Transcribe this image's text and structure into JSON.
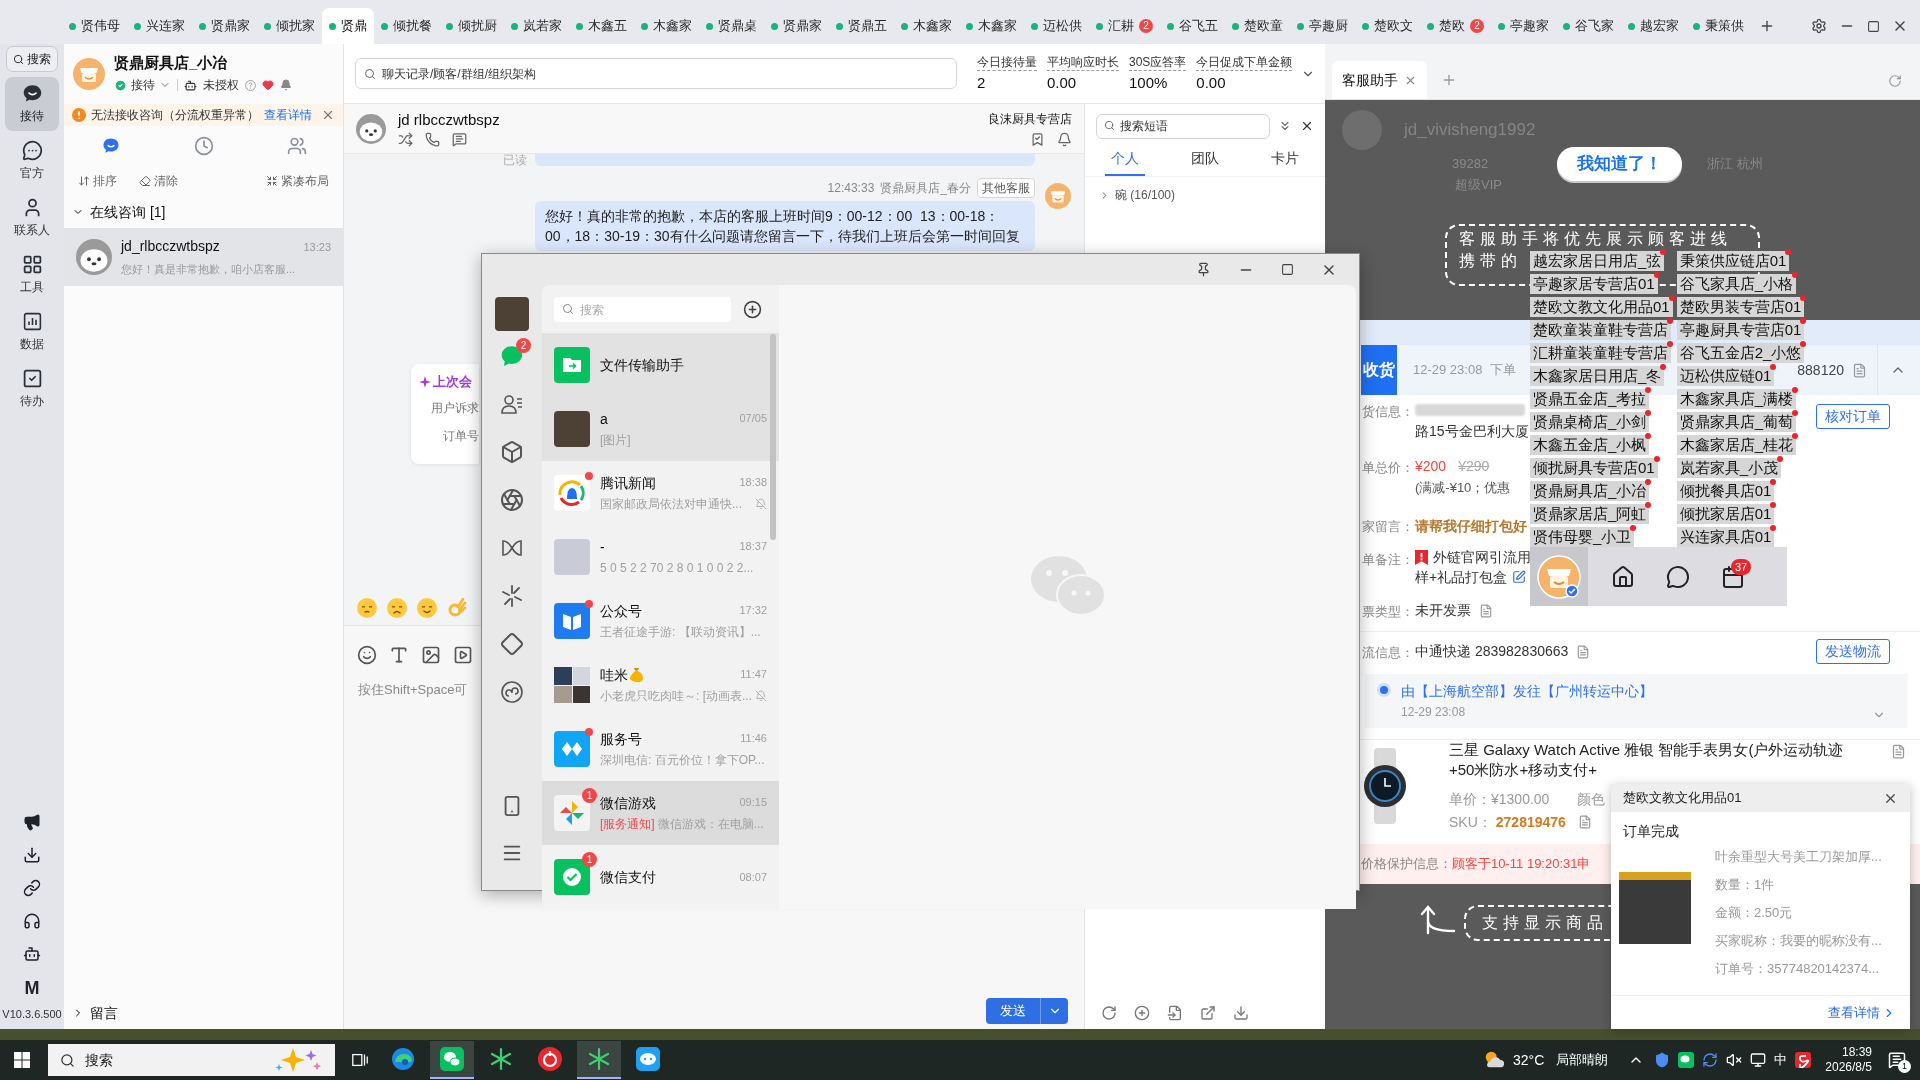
{
  "top_tabs": [
    {
      "label": "贤伟母",
      "selected": false
    },
    {
      "label": "兴连家",
      "selected": false
    },
    {
      "label": "贤鼎家",
      "selected": false
    },
    {
      "label": "倾扰家",
      "selected": false
    },
    {
      "label": "贤鼎",
      "selected": true
    },
    {
      "label": "倾扰餐",
      "selected": false
    },
    {
      "label": "倾扰厨",
      "selected": false
    },
    {
      "label": "岚若家",
      "selected": false
    },
    {
      "label": "木鑫五",
      "selected": false
    },
    {
      "label": "木鑫家",
      "selected": false
    },
    {
      "label": "贤鼎桌",
      "selected": false
    },
    {
      "label": "贤鼎家",
      "selected": false
    },
    {
      "label": "贤鼎五",
      "selected": false
    },
    {
      "label": "木鑫家",
      "selected": false
    },
    {
      "label": "木鑫家",
      "selected": false
    },
    {
      "label": "迈松供",
      "selected": false
    },
    {
      "label": "汇耕",
      "selected": false,
      "badge": "2"
    },
    {
      "label": "谷飞五",
      "selected": false
    },
    {
      "label": "楚欧童",
      "selected": false
    },
    {
      "label": "亭趣厨",
      "selected": false
    },
    {
      "label": "楚欧文",
      "selected": false
    },
    {
      "label": "楚欧",
      "selected": false,
      "badge": "2"
    },
    {
      "label": "亭趣家",
      "selected": false
    },
    {
      "label": "谷飞家",
      "selected": false
    },
    {
      "label": "越宏家",
      "selected": false
    },
    {
      "label": "秉策供",
      "selected": false
    }
  ],
  "rail": {
    "search": "搜索",
    "items": [
      {
        "label": "接待",
        "selected": true
      },
      {
        "label": "官方",
        "selected": false
      },
      {
        "label": "联系人",
        "selected": false
      },
      {
        "label": "工具",
        "selected": false
      },
      {
        "label": "数据",
        "selected": false
      },
      {
        "label": "待办",
        "selected": false
      }
    ],
    "logo": "M",
    "version": "V10.3.6.500"
  },
  "shop": {
    "name": "贤鼎厨具店_小冶",
    "status": "接待",
    "auth": "未授权",
    "alert": {
      "text": "无法接收咨询（分流权重异常）",
      "link": "查看详情"
    },
    "views": [
      {
        "selected": true
      },
      {
        "selected": false
      },
      {
        "selected": false
      }
    ],
    "actions": [
      "排序",
      "清除",
      "紧凑布局"
    ]
  },
  "groups": [
    {
      "title": "在线咨询 [1]",
      "expanded": true,
      "conversations": [
        {
          "name": "jd_rlbcczwtbspz",
          "time": "13:23",
          "preview": "您好！真是非常抱歉，咱小店客服...",
          "selected": true
        }
      ]
    }
  ],
  "footer_group": {
    "title": "留言",
    "expanded": false
  },
  "global_search": {
    "placeholder": "聊天记录/顾客/群组/组织架构"
  },
  "stats": [
    {
      "label": "今日接待量",
      "value": "2"
    },
    {
      "label": "平均响应时长",
      "value": "0.00"
    },
    {
      "label": "30S应答率",
      "value": "100%"
    },
    {
      "label": "今日促成下单金额",
      "value": "0.00"
    }
  ],
  "chat": {
    "customer": "jd rlbcczwtbspz",
    "store": "良沫厨具专营店",
    "messages": [
      {
        "kind": "cut",
        "status": "已读"
      },
      {
        "kind": "agent",
        "time": "12:43:33",
        "sender": "贤鼎厨具店_春分",
        "tag": "其他客服",
        "text": "您好！真的非常的抱歉，本店的客服上班时间9：00-12：00  13：00-18：00，18：30-19：30有什么问题请您留言一下，待我们上班后会第一时间回复"
      }
    ],
    "summary": {
      "title": "上次会",
      "lines": [
        "用户诉求",
        "订单号"
      ]
    },
    "input": {
      "placeholder": "按住Shift+Space可"
    },
    "send": "发送"
  },
  "phrases": {
    "search": {
      "placeholder": "搜索短语"
    },
    "tabs": [
      {
        "label": "个人",
        "selected": true
      },
      {
        "label": "团队",
        "selected": false
      },
      {
        "label": "卡片",
        "selected": false
      }
    ],
    "folders": [
      {
        "label": "碗 (16/100)",
        "expanded": false
      }
    ]
  },
  "assistant": {
    "tabs": [
      {
        "label": "客服助手",
        "selected": true
      }
    ],
    "profile_name": "jd_vivisheng1992",
    "profile_fields": [
      "39282",
      "浙江 杭州",
      "超级VIP"
    ],
    "guide": {
      "button": "我知道了！",
      "top_lines": [
        "客服助手将优先展示顾客进线",
        "携带的"
      ],
      "bottom_text": "支持显示商品"
    },
    "order": {
      "status": "收货",
      "time": "12-29 23:08",
      "type": "下单",
      "number": "888120",
      "address_label": "货信息：",
      "address": "路15号金巴利大厦",
      "check_button": "核对订单",
      "price_label": "单总价：",
      "price": "¥200",
      "original_price": "¥290",
      "discount": "(满减-¥10；优惠",
      "message_label": "家留言：",
      "message": "请帮我仔细打包好",
      "remark_label": "单备注：",
      "remark": "外链官网引流用",
      "remark_2": "样+礼品打包盒",
      "invoice_label": "票类型：",
      "invoice": "未开发票",
      "logistics_label": "流信息：",
      "logistics": "中通快递 283982830663",
      "logistics_button": "发送物流",
      "route": "由【上海航空部】发往【广州转运中心】",
      "route_time": "12-29 23:08",
      "product": {
        "title": "三星 Galaxy Watch Active 雅银 智能手表男女(户外运动轨迹+50米防水+移动支付+",
        "unit_price": "单价：¥1300.00",
        "color_label": "颜色",
        "sku_label": "SKU：",
        "sku": "272819476"
      },
      "protection_label": "价格保护信息：",
      "protection": "顾客于10-11 19:20:31申"
    },
    "shop_tags": [
      "越宏家居日用店_弦",
      "秉策供应链店01",
      "亭趣家居专营店01",
      "谷飞家具店_小格",
      "楚欧文教文化用品01",
      "楚欧男装专营店01",
      "楚欧童装童鞋专营店",
      "亭趣厨具专营店01",
      "汇耕童装童鞋专营店",
      "谷飞五金店2_小悠",
      "木鑫家居日用店_冬",
      "迈松供应链01",
      "贤鼎五金店_考拉",
      "木鑫家具店_满楼",
      "贤鼎桌椅店_小剑",
      "贤鼎家具店_葡萄",
      "木鑫五金店_小枫",
      "木鑫家居店_桂花",
      "倾扰厨具专营店01",
      "岚若家具_小茂",
      "贤鼎厨具店_小冶",
      "倾扰餐具店01",
      "贤鼎家居店_阿虹",
      "倾扰家居店01",
      "贤伟母婴_小卫",
      "兴连家具店01"
    ],
    "toolbar": {
      "badge": "37"
    },
    "notification": {
      "title": "楚欧文教文化用品01",
      "status": "订单完成",
      "product": "叶余重型大号美工刀架加厚...",
      "fields": [
        "数量：1件",
        "金额：2.50元",
        "买家昵称：我要的昵称没有...",
        "订单号：35774820142374..."
      ],
      "link": "查看详情"
    }
  },
  "wechat": {
    "nav": [
      {
        "selected": true,
        "badge": "2"
      },
      {
        "selected": false
      },
      {
        "selected": false
      },
      {
        "selected": false
      },
      {
        "selected": false
      },
      {
        "selected": false
      },
      {
        "selected": false
      },
      {
        "selected": false
      }
    ],
    "search": {
      "placeholder": "搜索"
    },
    "chats": [
      {
        "name": "文件传输助手",
        "pinned": true,
        "hovered": false,
        "dot": false,
        "muted": false
      },
      {
        "name": "a",
        "time": "07/05",
        "preview": "[图片]",
        "pinned": true,
        "hovered": false,
        "dot": false,
        "muted": false
      },
      {
        "name": "腾讯新闻",
        "time": "18:38",
        "preview": "国家邮政局依法对申通快...",
        "pinned": false,
        "hovered": false,
        "dot": true,
        "muted": true
      },
      {
        "name": "-",
        "time": "18:37",
        "preview": "5 0 5 2 2 70 2 8 0 1 0 0 2 2...",
        "pinned": false,
        "hovered": false,
        "dot": false,
        "muted": false
      },
      {
        "name": "公众号",
        "time": "17:32",
        "preview": "王者征途手游: 【联动资讯】...",
        "pinned": false,
        "hovered": false,
        "dot": true,
        "muted": false
      },
      {
        "name": "哇米",
        "time": "11:47",
        "preview": "小老虎只吃肉哇～: [动画表...",
        "pinned": false,
        "hovered": false,
        "dot": false,
        "muted": true
      },
      {
        "name": "服务号",
        "time": "11:46",
        "preview": "深圳电信: 百元价位！拿下OP...",
        "pinned": false,
        "hovered": false,
        "dot": true,
        "muted": false
      },
      {
        "name": "微信游戏",
        "time": "09:15",
        "tag": "[服务通知]",
        "preview": "微信游戏：在电脑...",
        "pinned": false,
        "hovered": true,
        "dot": false,
        "muted": false,
        "badge": "1"
      },
      {
        "name": "微信支付",
        "time": "08:07",
        "pinned": false,
        "hovered": false,
        "dot": false,
        "muted": false,
        "badge": "1"
      }
    ]
  },
  "taskbar": {
    "search": {
      "placeholder": "搜索"
    },
    "apps": [
      {
        "active": false
      },
      {
        "active": true
      },
      {
        "active": false
      },
      {
        "active": false
      },
      {
        "active": true
      },
      {
        "active": false
      }
    ],
    "temperature": "32°C",
    "weather": "局部晴朗",
    "ime": "中",
    "time": "18:39",
    "date": "2026/8/5",
    "notifications": "1"
  }
}
